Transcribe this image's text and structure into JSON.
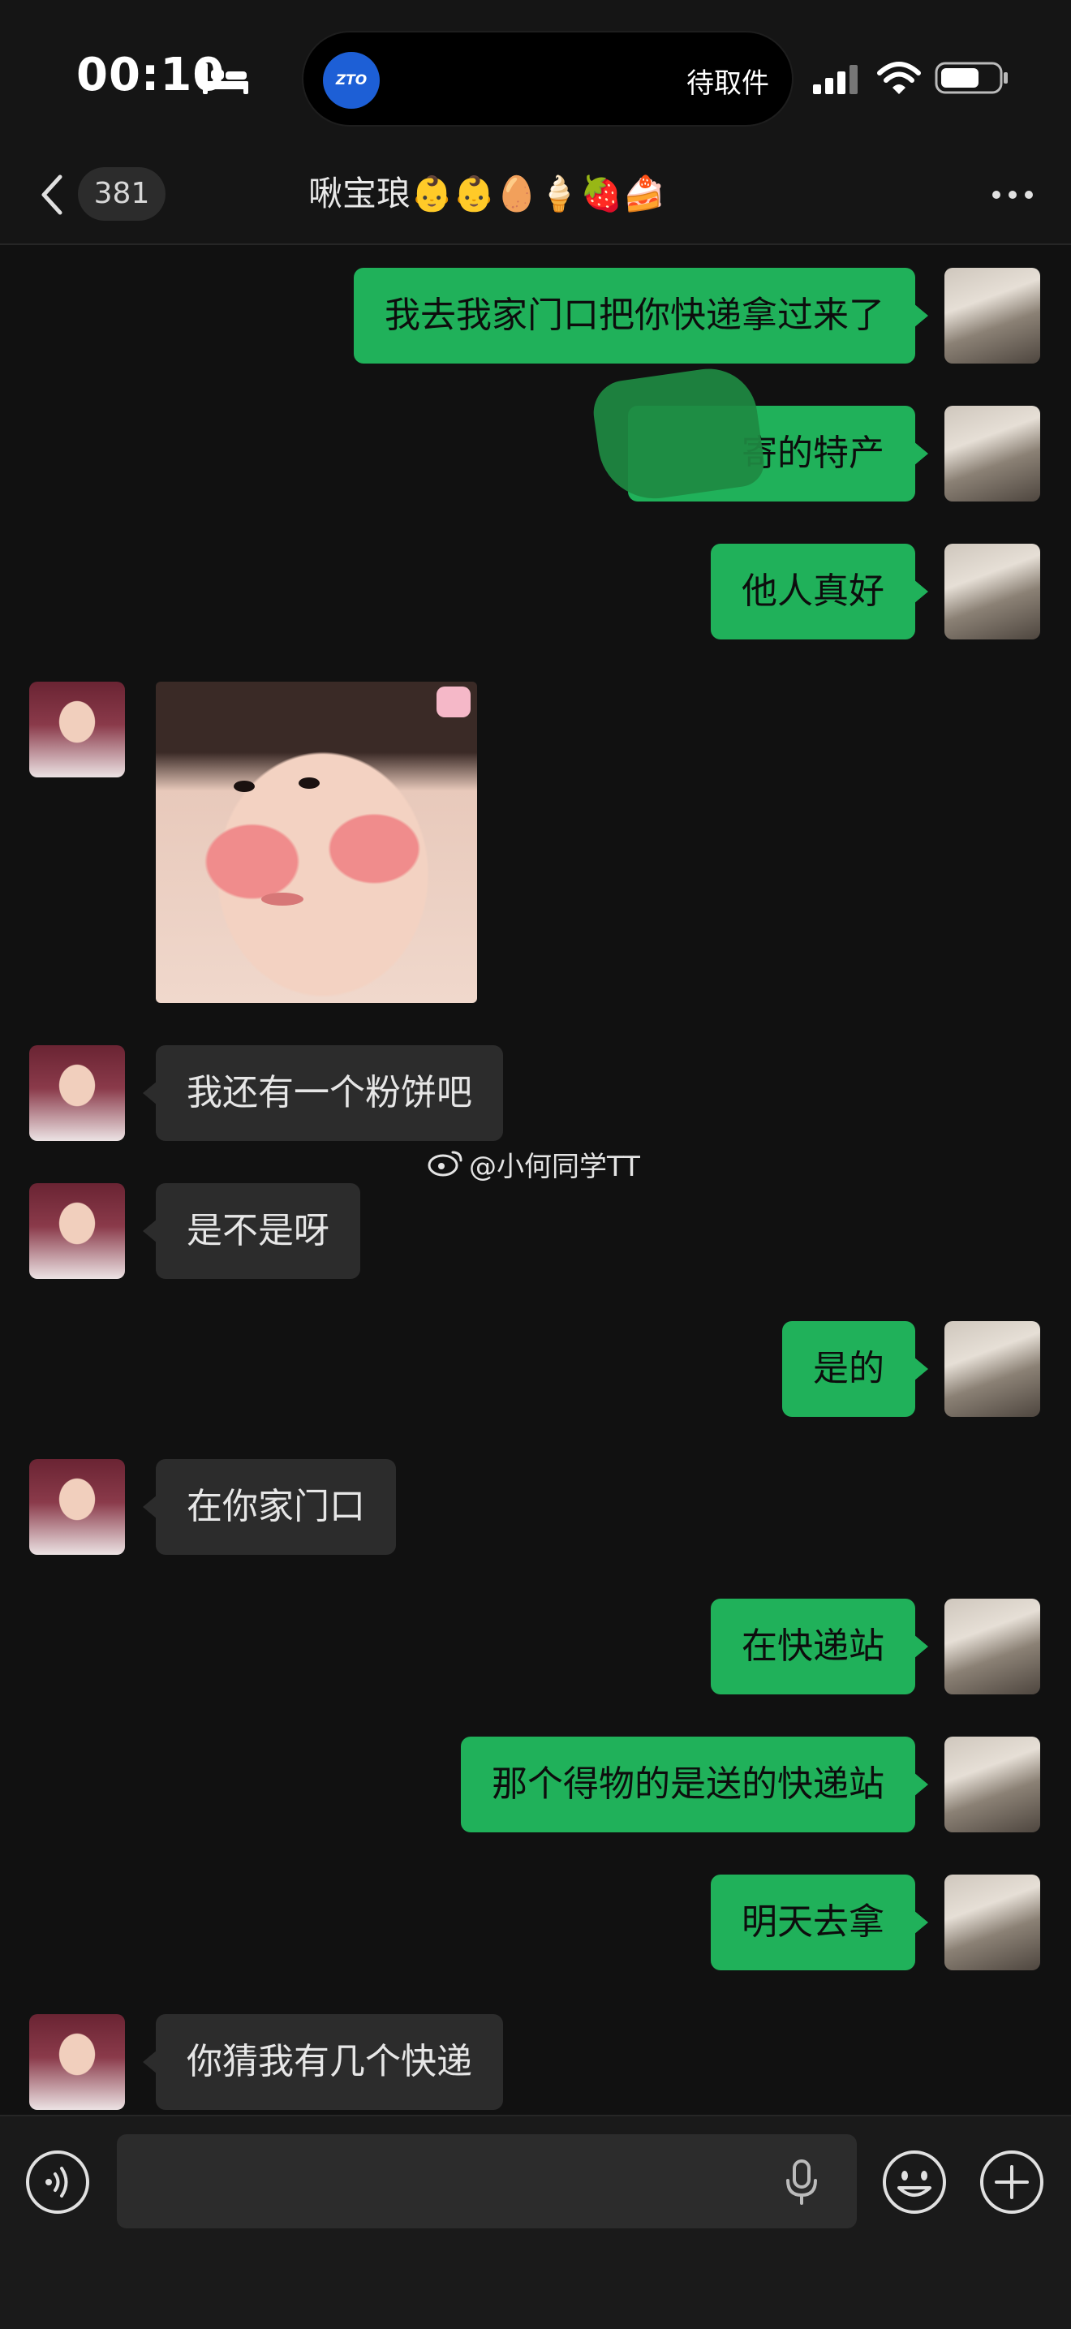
{
  "status_bar": {
    "time": "00:10",
    "island_app_logo": "ZTO",
    "island_text": "待取件"
  },
  "header": {
    "unread_count": "381",
    "title": "啾宝琅👶👶🥚🍦🍓🍰"
  },
  "messages": [
    {
      "sender": "me",
      "text": "我去我家门口把你快递拿过来了"
    },
    {
      "sender": "me",
      "text": "寄的特产",
      "redacted_prefix": true
    },
    {
      "sender": "me",
      "text": "他人真好"
    },
    {
      "sender": "them",
      "type": "image",
      "description_icon": "baby-photo"
    },
    {
      "sender": "them",
      "text": "我还有一个粉饼吧"
    },
    {
      "sender": "them",
      "text": "是不是呀"
    },
    {
      "sender": "me",
      "text": "是的"
    },
    {
      "sender": "them",
      "text": "在你家门口"
    },
    {
      "sender": "me",
      "text": "在快递站"
    },
    {
      "sender": "me",
      "text": "那个得物的是送的快递站"
    },
    {
      "sender": "me",
      "text": "明天去拿"
    },
    {
      "sender": "them",
      "text": "你猜我有几个快递"
    }
  ],
  "watermark": "@小何同学TT",
  "input": {
    "value": "",
    "placeholder": ""
  },
  "colors": {
    "background": "#111111",
    "my_bubble": "#20b15a",
    "their_bubble": "#2c2c2c",
    "accent_blue": "#1d5fd6"
  }
}
